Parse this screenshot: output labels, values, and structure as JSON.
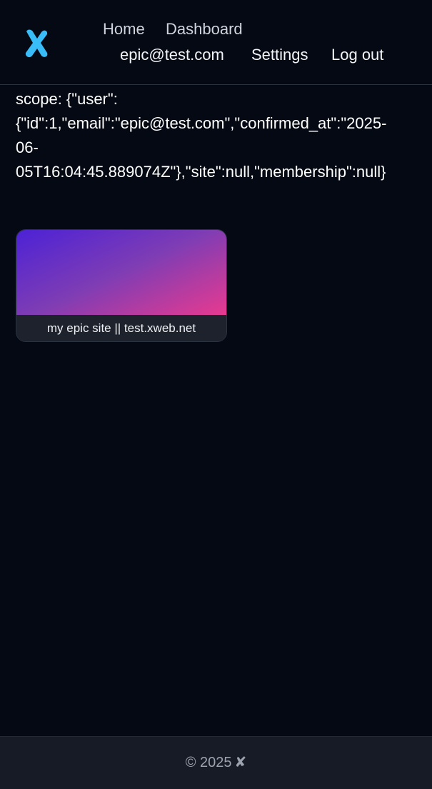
{
  "header": {
    "logo": "x-logo-icon",
    "nav": {
      "home": "Home",
      "dashboard": "Dashboard",
      "user_email": "epic@test.com",
      "settings": "Settings",
      "logout": "Log out"
    }
  },
  "scope": {
    "lines": [
      "scope: {\"user\":",
      "{\"id\":1,\"email\":\"epic@test.com\",\"confirmed_at\":\"2025-",
      "06-",
      "05T16:04:45.889074Z\"},\"site\":null,\"membership\":null}"
    ]
  },
  "sites": [
    {
      "caption": "my epic site || test.xweb.net"
    }
  ],
  "footer": {
    "copyright": "© 2025",
    "mark": "✘"
  },
  "colors": {
    "background": "#050914",
    "logo": "#38bdf8",
    "gradient_start": "#4c22d6",
    "gradient_end": "#e83a8f"
  }
}
